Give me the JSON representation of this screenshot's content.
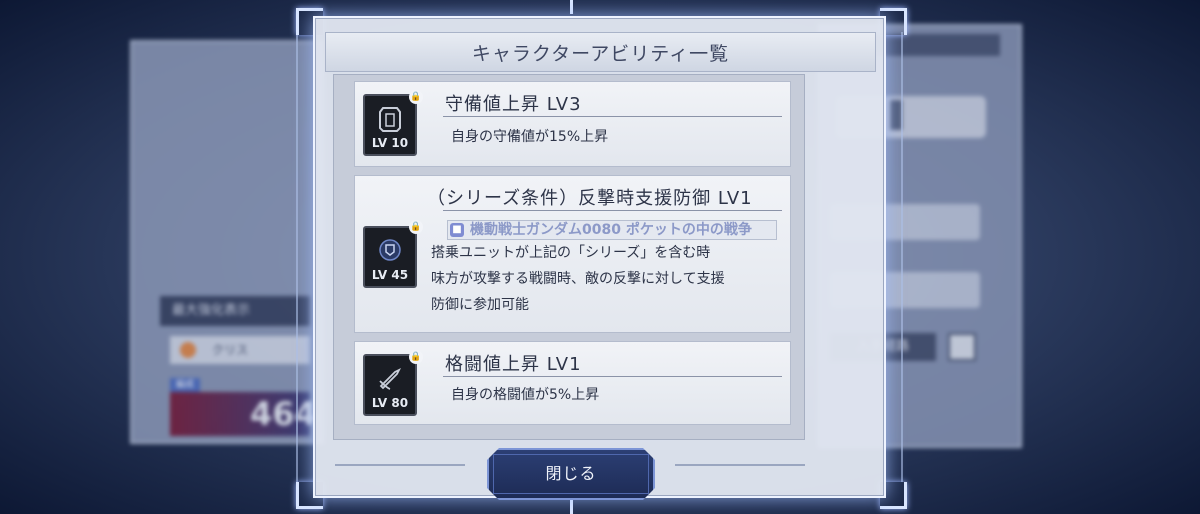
{
  "dialog": {
    "title": "キャラクターアビリティ一覧",
    "close_label": "閉じる"
  },
  "abilities": [
    {
      "name": "守備値上昇 LV3",
      "level_label": "LV 10",
      "icon": "shield-icon",
      "locked": true,
      "lines": [
        "自身の守備値が15%上昇"
      ]
    },
    {
      "name": "（シリーズ条件）反撃時支援防御 LV1",
      "level_label": "LV 45",
      "icon": "defense-badge-icon",
      "locked": true,
      "series": "機動戦士ガンダム0080 ポケットの中の戦争",
      "lines": [
        "搭乗ユニットが上記の「シリーズ」を含む時",
        "味方が攻撃する戦闘時、敵の反撃に対して支援",
        "防御に参加可能"
      ]
    },
    {
      "name": "格闘値上昇 LV1",
      "level_label": "LV 80",
      "icon": "melee-icon",
      "locked": true,
      "lines": [
        "自身の格闘値が5%上昇"
      ]
    }
  ],
  "background": {
    "left_strip_label": "最大強化表示",
    "left_row_label": "クリス",
    "left_chip": "編成",
    "left_big_number": "464",
    "right_button_label": "入手経路"
  },
  "colors": {
    "dialog_bg": "#e1e6f0",
    "accent_blue": "#2c3f74",
    "series_text": "#8c99c8"
  }
}
